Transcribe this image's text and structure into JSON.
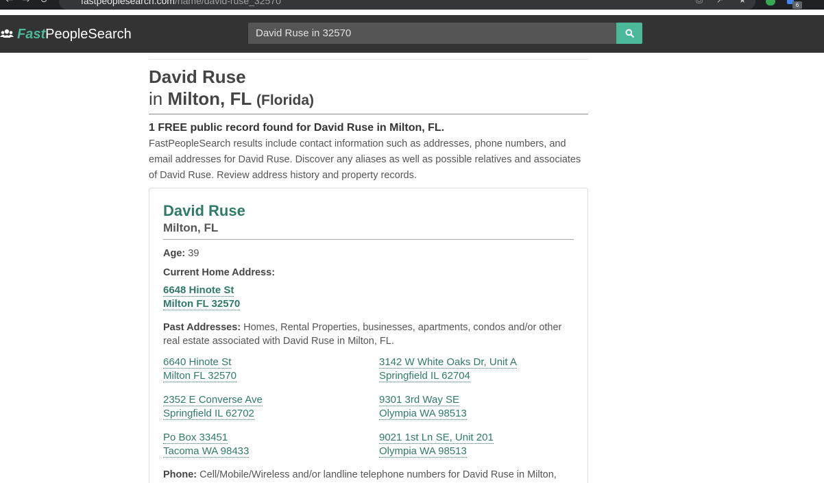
{
  "browser": {
    "url_host": "fastpeoplesearch.com",
    "url_path": "/name/david-ruse_32570"
  },
  "site": {
    "logo_fast": "Fast",
    "logo_people": "PeopleSearch",
    "search_value": "David Ruse in 32570",
    "accent_color": "#4bb89a"
  },
  "heading": {
    "name": "David Ruse",
    "in": "in",
    "city": "Milton, FL",
    "state_full": "(Florida)"
  },
  "summary": {
    "bold": "1 FREE public record found for David Ruse in Milton, FL.",
    "text": "FastPeopleSearch results include contact information such as addresses, phone numbers, and email addresses for David Ruse. Discover any aliases as well as possible relatives and associates of David Ruse. Review address history and property records."
  },
  "card": {
    "name": "David Ruse",
    "location": "Milton, FL",
    "age_label": "Age:",
    "age_value": "39",
    "current_label": "Current Home Address:",
    "current_line1": "6648 Hinote St",
    "current_line2": "Milton FL 32570",
    "past_label": "Past Addresses:",
    "past_text": "Homes, Rental Properties, businesses, apartments, condos and/or other real estate associated with David Ruse in Milton, FL.",
    "past_addresses": [
      {
        "line1": "6640 Hinote St",
        "line2": "Milton FL 32570"
      },
      {
        "line1": "3142 W White Oaks Dr, Unit A",
        "line2": "Springfield IL 62704"
      },
      {
        "line1": "2352 E Converse Ave",
        "line2": "Springfield IL 62702"
      },
      {
        "line1": "9301 3rd Way SE",
        "line2": "Olympia WA 98513"
      },
      {
        "line1": "Po Box 33451",
        "line2": "Tacoma WA 98433"
      },
      {
        "line1": "9021 1st Ln SE, Unit 201",
        "line2": "Olympia WA 98513"
      }
    ],
    "phone_label": "Phone:",
    "phone_text": "Cell/Mobile/Wireless and/or landline telephone numbers for David Ruse in Milton,"
  },
  "icons": {
    "logo": "people-group-icon",
    "search": "search-icon"
  },
  "extensions": {
    "badge_count": "6"
  }
}
